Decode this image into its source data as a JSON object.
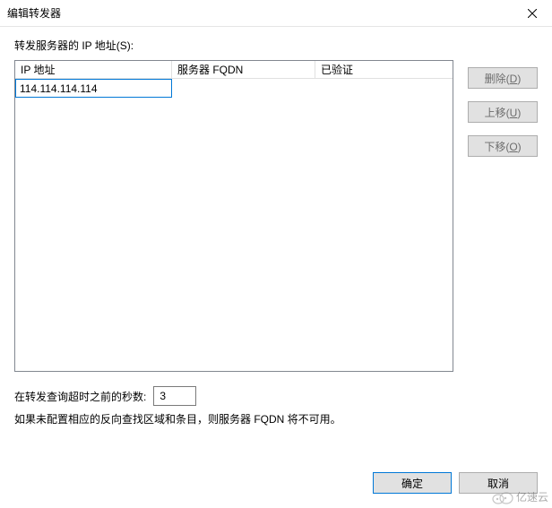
{
  "dialog": {
    "title": "编辑转发器",
    "close_icon": "close"
  },
  "form": {
    "servers_label": "转发服务器的 IP 地址(S):"
  },
  "table": {
    "headers": {
      "ip": "IP 地址",
      "fqdn": "服务器 FQDN",
      "verified": "已验证"
    },
    "rows": [
      {
        "ip": "114.114.114.114",
        "fqdn": "",
        "verified": ""
      }
    ]
  },
  "side_buttons": {
    "delete": "删除(D)",
    "move_up": "上移(U)",
    "move_down": "下移(O)"
  },
  "timeout": {
    "label": "在转发查询超时之前的秒数:",
    "value": "3"
  },
  "note": "如果未配置相应的反向查找区域和条目，则服务器 FQDN 将不可用。",
  "dialog_buttons": {
    "ok": "确定",
    "cancel": "取消"
  },
  "watermark": "亿速云"
}
